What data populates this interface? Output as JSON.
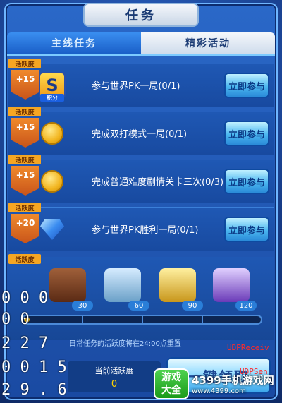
{
  "title": "任务",
  "tabs": [
    {
      "label": "主线任务",
      "active": false
    },
    {
      "label": "精彩活动",
      "active": true
    }
  ],
  "ribbon_label": "活跃度",
  "tasks": [
    {
      "points": "+15",
      "icon": "s-points-badge",
      "icon_letter": "S",
      "icon_sub": "积分",
      "text": "参与世界PK一局(0/1)",
      "button": "立即参与"
    },
    {
      "points": "+15",
      "icon": "gold-coin-icon",
      "text": "完成双打模式一局(0/1)",
      "button": "立即参与"
    },
    {
      "points": "+15",
      "icon": "gold-coin-icon",
      "text": "完成普通难度剧情关卡三次(0/3)",
      "button": "立即参与"
    },
    {
      "points": "+20",
      "icon": "blue-diamond-icon",
      "text": "参与世界PK胜利一局(0/1)",
      "button": "立即参与"
    }
  ],
  "chests": [
    {
      "threshold": "30",
      "color": "#8a4a2a"
    },
    {
      "threshold": "60",
      "color": "#9ec8e8"
    },
    {
      "threshold": "90",
      "color": "#e8c23a"
    },
    {
      "threshold": "120",
      "color": "#9a6ad8"
    }
  ],
  "progress": {
    "current": 0,
    "max": 120
  },
  "note": "日常任务的活跃度将在24:00点重置",
  "current_activity_label": "当前活跃度",
  "current_activity_value": "0",
  "claim_button": "一键领取",
  "debug_overlay": [
    "0 0 0",
    "0 0",
    "2 2 7",
    "0 0 1 5",
    "2 9 . 6"
  ],
  "udp": [
    "UDPReceiv",
    "UDPSen"
  ],
  "watermark": {
    "logo_line1": "游戏",
    "logo_line2": "大全",
    "site_name": "4399手机游戏网",
    "url": "www.4399.com"
  }
}
